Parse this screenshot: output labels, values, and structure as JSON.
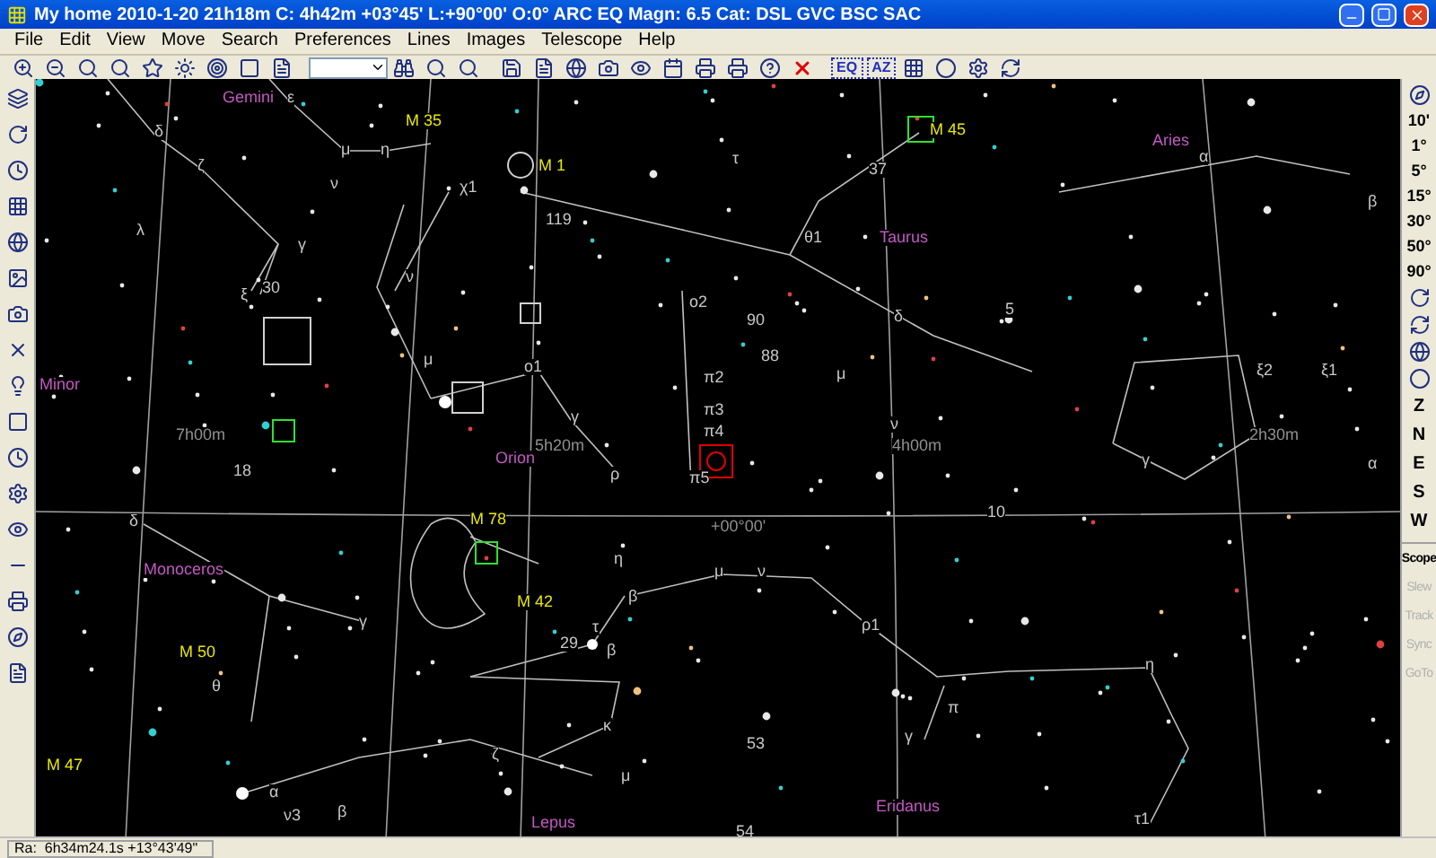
{
  "window": {
    "title": "My home 2010-1-20  21h18m C:  4h42m +03°45' L:+90°00' O:0° ARC EQ Magn: 6.5 Cat: DSL GVC BSC SAC"
  },
  "menu": [
    "File",
    "Edit",
    "View",
    "Move",
    "Search",
    "Preferences",
    "Lines",
    "Images",
    "Telescope",
    "Help"
  ],
  "toolbar": {
    "projection_buttons": [
      "EQ",
      "AZ"
    ]
  },
  "chart": {
    "labels": [
      {
        "text": "Gemini",
        "kind": "constellation"
      },
      {
        "text": "ε",
        "kind": "star"
      },
      {
        "text": "M 35",
        "kind": "object"
      },
      {
        "text": "M 1",
        "kind": "object"
      },
      {
        "text": "M 45",
        "kind": "object"
      },
      {
        "text": "Aries",
        "kind": "constellation"
      },
      {
        "text": "δ",
        "kind": "star"
      },
      {
        "text": "ζ",
        "kind": "star"
      },
      {
        "text": "μ",
        "kind": "star"
      },
      {
        "text": "η",
        "kind": "star"
      },
      {
        "text": "ν",
        "kind": "star"
      },
      {
        "text": "χ1",
        "kind": "star"
      },
      {
        "text": "119",
        "kind": "star"
      },
      {
        "text": "τ",
        "kind": "star"
      },
      {
        "text": "37",
        "kind": "star"
      },
      {
        "text": "λ",
        "kind": "star"
      },
      {
        "text": "γ",
        "kind": "star"
      },
      {
        "text": "ν",
        "kind": "star"
      },
      {
        "text": "ξ",
        "kind": "star"
      },
      {
        "text": "30",
        "kind": "star"
      },
      {
        "text": "θ1",
        "kind": "star"
      },
      {
        "text": "Taurus",
        "kind": "constellation"
      },
      {
        "text": "ο2",
        "kind": "star"
      },
      {
        "text": "μ",
        "kind": "star"
      },
      {
        "text": "ο1",
        "kind": "star"
      },
      {
        "text": "γ",
        "kind": "star"
      },
      {
        "text": "π2",
        "kind": "star"
      },
      {
        "text": "π3",
        "kind": "star"
      },
      {
        "text": "π4",
        "kind": "star"
      },
      {
        "text": "π5",
        "kind": "star"
      },
      {
        "text": "90",
        "kind": "star"
      },
      {
        "text": "88",
        "kind": "star"
      },
      {
        "text": "5",
        "kind": "star"
      },
      {
        "text": "δ",
        "kind": "star"
      },
      {
        "text": "μ",
        "kind": "star"
      },
      {
        "text": "ξ2",
        "kind": "star"
      },
      {
        "text": "ξ1",
        "kind": "star"
      },
      {
        "text": "ν",
        "kind": "star"
      },
      {
        "text": "7h00m",
        "kind": "grid"
      },
      {
        "text": "5h20m",
        "kind": "grid"
      },
      {
        "text": "4h00m",
        "kind": "grid"
      },
      {
        "text": "2h30m",
        "kind": "grid"
      },
      {
        "text": "Orion",
        "kind": "constellation"
      },
      {
        "text": "Minor",
        "kind": "constellation"
      },
      {
        "text": "ρ",
        "kind": "star"
      },
      {
        "text": "γ",
        "kind": "star"
      },
      {
        "text": "α",
        "kind": "star"
      },
      {
        "text": "10",
        "kind": "star"
      },
      {
        "text": "+00°00'",
        "kind": "grid"
      },
      {
        "text": "18",
        "kind": "star"
      },
      {
        "text": "δ",
        "kind": "star"
      },
      {
        "text": "M 78",
        "kind": "object"
      },
      {
        "text": "η",
        "kind": "star"
      },
      {
        "text": "Monoceros",
        "kind": "constellation"
      },
      {
        "text": "β",
        "kind": "star"
      },
      {
        "text": "μ",
        "kind": "star"
      },
      {
        "text": "ν",
        "kind": "star"
      },
      {
        "text": "M 42",
        "kind": "object"
      },
      {
        "text": "γ",
        "kind": "star"
      },
      {
        "text": "τ",
        "kind": "star"
      },
      {
        "text": "ρ1",
        "kind": "star"
      },
      {
        "text": "M 50",
        "kind": "object"
      },
      {
        "text": "29",
        "kind": "star"
      },
      {
        "text": "β",
        "kind": "star"
      },
      {
        "text": "θ",
        "kind": "star"
      },
      {
        "text": "η",
        "kind": "star"
      },
      {
        "text": "π",
        "kind": "star"
      },
      {
        "text": "γ",
        "kind": "star"
      },
      {
        "text": "κ",
        "kind": "star"
      },
      {
        "text": "53",
        "kind": "star"
      },
      {
        "text": "ζ",
        "kind": "star"
      },
      {
        "text": "μ",
        "kind": "star"
      },
      {
        "text": "α",
        "kind": "star"
      },
      {
        "text": "ν3",
        "kind": "star"
      },
      {
        "text": "β",
        "kind": "star"
      },
      {
        "text": "M 47",
        "kind": "object"
      },
      {
        "text": "54",
        "kind": "star"
      },
      {
        "text": "Lepus",
        "kind": "constellation"
      },
      {
        "text": "Eridanus",
        "kind": "constellation"
      },
      {
        "text": "τ1",
        "kind": "star"
      },
      {
        "text": "α",
        "kind": "star"
      },
      {
        "text": "β",
        "kind": "star"
      }
    ]
  },
  "right_toolbar": {
    "fields_of_view": [
      "10'",
      "1°",
      "5°",
      "15°",
      "30°",
      "50°",
      "90°"
    ],
    "directions": [
      "Z",
      "N",
      "E",
      "S",
      "W"
    ],
    "telescope": [
      {
        "label": "Scope",
        "disabled": false
      },
      {
        "label": "Slew",
        "disabled": true
      },
      {
        "label": "Track",
        "disabled": true
      },
      {
        "label": "Sync",
        "disabled": true
      },
      {
        "label": "GoTo",
        "disabled": true
      }
    ]
  },
  "status_bar": {
    "text": "Ra:  6h34m24.1s +13°43'49\""
  }
}
